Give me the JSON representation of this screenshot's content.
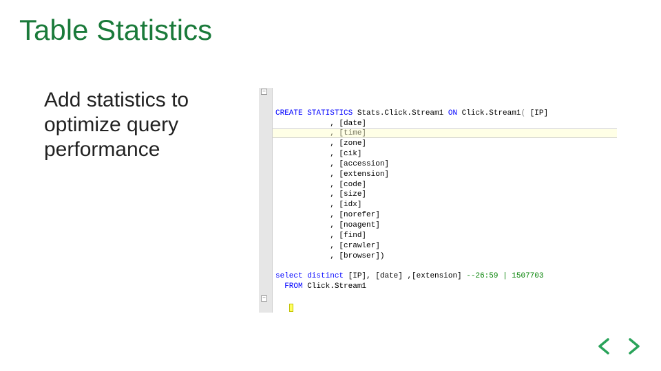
{
  "title": "Table Statistics",
  "subtitle": "Add statistics to optimize query performance",
  "code": {
    "line1_kw1": "CREATE STATISTICS",
    "line1_obj": " Stats.Click.Stream1 ",
    "line1_kw2": "ON",
    "line1_tbl": " Click.Stream1",
    "line1_open": "(",
    "line1_col": " [IP]",
    "cols": [
      ", [date]",
      ", [time]",
      ", [zone]",
      ", [cik]",
      ", [accession]",
      ", [extension]",
      ", [code]",
      ", [size]",
      ", [idx]",
      ", [norefer]",
      ", [noagent]",
      ", [find]",
      ", [crawler]",
      ", [browser])"
    ],
    "sel_kw": "select distinct",
    "sel_cols": " [IP], [date] ,[extension] ",
    "sel_comment": "--26:59 | 1507703",
    "from_kw": "FROM",
    "from_tbl": " Click.Stream1"
  },
  "fold_glyph": "−",
  "colors": {
    "accent": "#1a7a3a"
  }
}
